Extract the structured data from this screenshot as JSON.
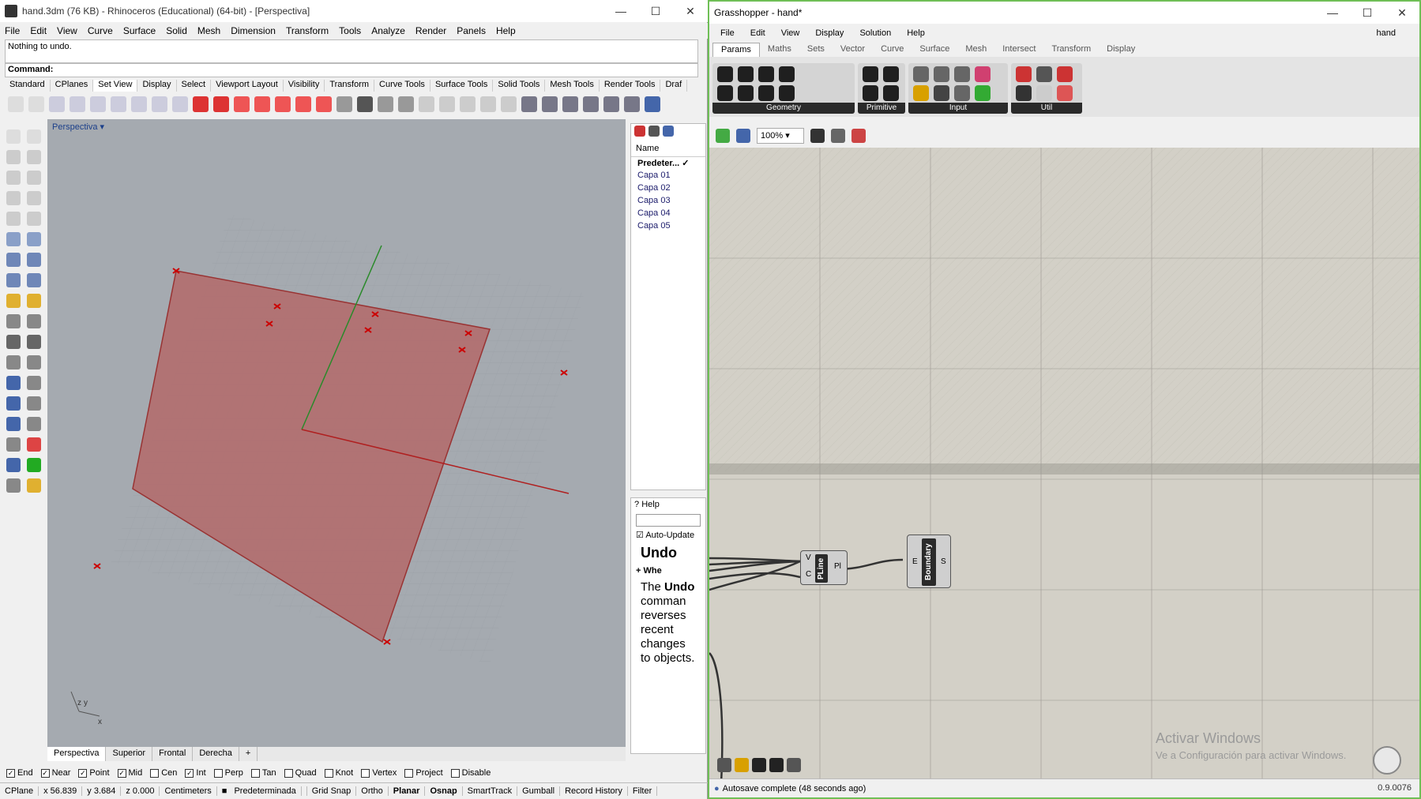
{
  "rhino": {
    "title": "hand.3dm (76 KB) - Rhinoceros (Educational) (64-bit) - [Perspectiva]",
    "menu": [
      "File",
      "Edit",
      "View",
      "Curve",
      "Surface",
      "Solid",
      "Mesh",
      "Dimension",
      "Transform",
      "Tools",
      "Analyze",
      "Render",
      "Panels",
      "Help"
    ],
    "command_history": "Nothing to undo.",
    "command_prompt": "Command:",
    "toolbar_tabs": [
      "Standard",
      "CPlanes",
      "Set View",
      "Display",
      "Select",
      "Viewport Layout",
      "Visibility",
      "Transform",
      "Curve Tools",
      "Surface Tools",
      "Solid Tools",
      "Mesh Tools",
      "Render Tools",
      "Draf"
    ],
    "active_toolbar_tab": "Set View",
    "viewport_label": "Perspectiva",
    "viewport_tabs": [
      "Perspectiva",
      "Superior",
      "Frontal",
      "Derecha"
    ],
    "axis_labels": {
      "z": "z",
      "y": "y",
      "x": "x"
    },
    "layers": {
      "header": "Name",
      "items": [
        "Predeter...",
        "Capa 01",
        "Capa 02",
        "Capa 03",
        "Capa 04",
        "Capa 05"
      ]
    },
    "help": {
      "tab": "Help",
      "auto_update": "Auto-Update",
      "topic": "Undo",
      "expand": "+ Whe",
      "body_prefix": "The",
      "body_bold": "Undo",
      "body_rest": "comman reverses recent changes to objects."
    },
    "osnap": [
      "End",
      "Near",
      "Point",
      "Mid",
      "Cen",
      "Int",
      "Perp",
      "Tan",
      "Quad",
      "Knot",
      "Vertex",
      "Project",
      "Disable"
    ],
    "osnap_checked": [
      "End",
      "Near",
      "Point",
      "Mid",
      "Int"
    ],
    "status": {
      "cplane": "CPlane",
      "x": "x 56.839",
      "y": "y 3.684",
      "z": "z 0.000",
      "units": "Centimeters",
      "layer": "Predeterminada",
      "toggles": [
        "Grid Snap",
        "Ortho",
        "Planar",
        "Osnap",
        "SmartTrack",
        "Gumball",
        "Record History",
        "Filter"
      ]
    },
    "colors": {
      "surface": "#b36a6a",
      "point": "#cc0000",
      "viewport_bg": "#a5aab0"
    }
  },
  "grasshopper": {
    "title": "Grasshopper - hand*",
    "doc_name": "hand",
    "menu": [
      "File",
      "Edit",
      "View",
      "Display",
      "Solution",
      "Help"
    ],
    "tabs": [
      "Params",
      "Maths",
      "Sets",
      "Vector",
      "Curve",
      "Surface",
      "Mesh",
      "Intersect",
      "Transform",
      "Display"
    ],
    "active_tab": "Params",
    "ribbon_groups": [
      "Geometry",
      "Primitive",
      "Input",
      "Util"
    ],
    "zoom": "100%",
    "components": {
      "pline": {
        "name": "PLine",
        "inputs": [
          "V",
          "C"
        ],
        "output": "Pl"
      },
      "boundary": {
        "name": "Boundary",
        "input": "E",
        "output": "S"
      }
    },
    "watermark_title": "Activar Windows",
    "watermark_text": "Ve a Configuración para activar Windows.",
    "status": "Autosave complete (48 seconds ago)",
    "version": "0.9.0076"
  }
}
